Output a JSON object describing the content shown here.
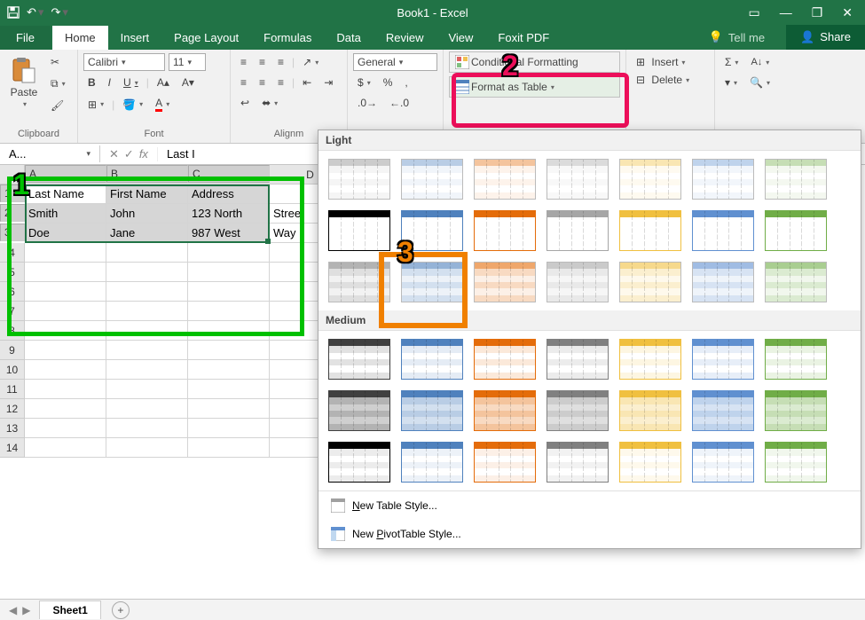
{
  "title": "Book1 - Excel",
  "tabs": {
    "file": "File",
    "home": "Home",
    "insert": "Insert",
    "page": "Page Layout",
    "formulas": "Formulas",
    "data": "Data",
    "review": "Review",
    "view": "View",
    "foxit": "Foxit PDF",
    "tellme": "Tell me",
    "share": "Share"
  },
  "ribbon": {
    "clipboard": "Clipboard",
    "paste": "Paste",
    "font": "Font",
    "fontname": "Calibri",
    "fontsize": "11",
    "alignment": "Alignm",
    "number": "General",
    "conditional": "Conditional Formatting",
    "format_table": "Format as Table",
    "insert": "Insert",
    "delete": "Delete"
  },
  "annotations": {
    "one": "1",
    "two": "2",
    "three": "3"
  },
  "fxbar": {
    "name": "A...",
    "formula": "Last I"
  },
  "columns": [
    "A",
    "B",
    "C",
    "D"
  ],
  "rows": [
    "1",
    "2",
    "3",
    "4",
    "5",
    "6",
    "7",
    "8",
    "9",
    "10",
    "11",
    "12",
    "13",
    "14"
  ],
  "data": [
    [
      "Last Name",
      "First Name",
      "Address",
      ""
    ],
    [
      "Smith",
      "John",
      "123 North",
      "Street"
    ],
    [
      "Doe",
      "Jane",
      "987 West",
      "Way"
    ],
    [
      "",
      "",
      "",
      ""
    ],
    [
      "",
      "",
      "",
      ""
    ],
    [
      "",
      "",
      "",
      ""
    ],
    [
      "",
      "",
      "",
      ""
    ],
    [
      "",
      "",
      "",
      ""
    ],
    [
      "",
      "",
      "",
      ""
    ],
    [
      "",
      "",
      "",
      ""
    ],
    [
      "",
      "",
      "",
      ""
    ],
    [
      "",
      "",
      "",
      ""
    ],
    [
      "",
      "",
      "",
      ""
    ],
    [
      "",
      "",
      "",
      ""
    ]
  ],
  "gallery": {
    "light": "Light",
    "medium": "Medium",
    "new_table": "New Table Style...",
    "new_pivot": "New PivotTable Style...",
    "light_colors": [
      "#808080",
      "#4f81bd",
      "#e46c0a",
      "#a6a6a6",
      "#f0c040",
      "#6090d0",
      "#70ad47"
    ],
    "medium_colors": [
      "#404040",
      "#4f81bd",
      "#e46c0a",
      "#808080",
      "#f0c040",
      "#6090d0",
      "#70ad47"
    ]
  },
  "sheet_tabs": {
    "sheet1": "Sheet1"
  }
}
